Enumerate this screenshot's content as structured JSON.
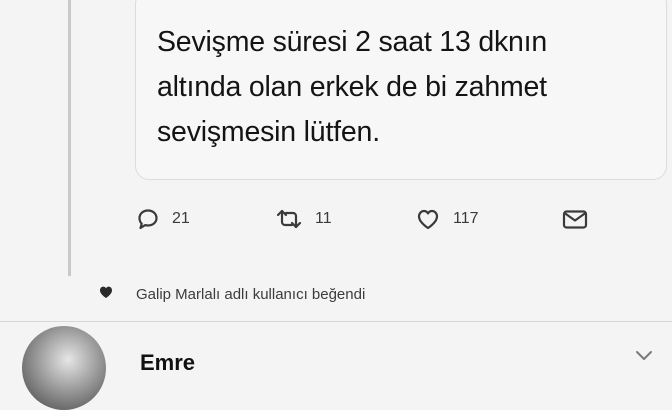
{
  "tweet": {
    "lines": [
      "Sevişme süresi 2 saat 13 dknın",
      "altında olan erkek de bi zahmet",
      "sevişmesin lütfen."
    ]
  },
  "actions": {
    "reply": {
      "icon": "reply-icon",
      "count": "21"
    },
    "retweet": {
      "icon": "retweet-icon",
      "count": "11"
    },
    "like": {
      "icon": "heart-icon",
      "count": "117"
    },
    "message": {
      "icon": "mail-icon"
    }
  },
  "activity": {
    "icon": "heart-filled-icon",
    "text": "Galip Marlalı adlı kullanıcı beğendi"
  },
  "next_tweet": {
    "author_name": "Emre",
    "menu_icon": "chevron-down-icon"
  }
}
